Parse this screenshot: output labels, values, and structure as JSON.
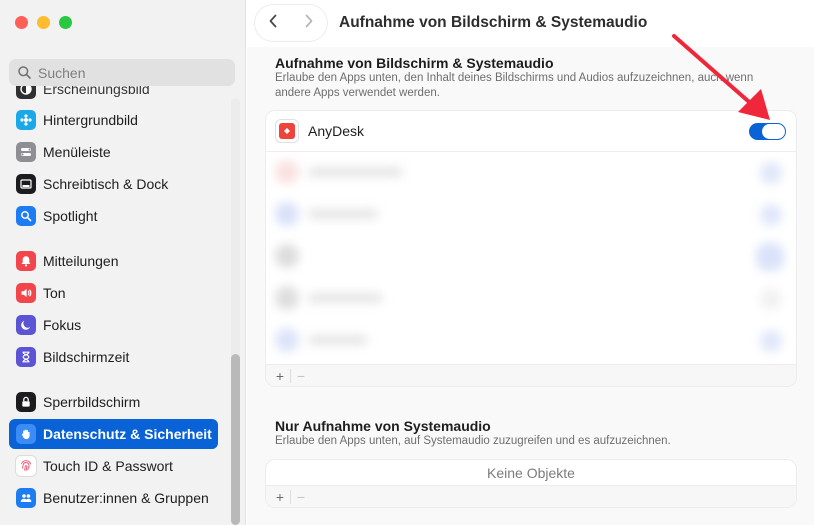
{
  "window": {
    "title": "Aufnahme von Bildschirm & Systemaudio"
  },
  "sidebar": {
    "search_placeholder": "Suchen",
    "hidden_item": "Erscheinungsbild",
    "items": [
      {
        "label": "Hintergrundbild",
        "icon": "wallpaper-icon",
        "color": "#1aa9e8"
      },
      {
        "label": "Menüleiste",
        "icon": "menu-bar-icon",
        "color": "#8e8e93"
      },
      {
        "label": "Schreibtisch & Dock",
        "icon": "dock-icon",
        "color": "#1c1c1e"
      },
      {
        "label": "Spotlight",
        "icon": "spotlight-icon",
        "color": "#1e7cf2"
      },
      {
        "label": "Mitteilungen",
        "icon": "notifications-icon",
        "color": "#f2454c"
      },
      {
        "label": "Ton",
        "icon": "sound-icon",
        "color": "#f2454c"
      },
      {
        "label": "Fokus",
        "icon": "focus-icon",
        "color": "#5b55d6"
      },
      {
        "label": "Bildschirmzeit",
        "icon": "screen-time-icon",
        "color": "#5b55d6"
      },
      {
        "label": "Sperrbildschirm",
        "icon": "lock-screen-icon",
        "color": "#1c1c1e"
      },
      {
        "label": "Datenschutz & Sicherheit",
        "icon": "privacy-hand-icon",
        "color": "#1e7cf2",
        "active": true
      },
      {
        "label": "Touch ID & Passwort",
        "icon": "fingerprint-icon",
        "color": "#ffffff"
      },
      {
        "label": "Benutzer:innen & Gruppen",
        "icon": "users-icon",
        "color": "#1e7cf2"
      }
    ]
  },
  "screen_audio": {
    "title": "Aufnahme von Bildschirm & Systemaudio",
    "description": "Erlaube den Apps unten, den Inhalt deines Bildschirms und Audios aufzuzeichnen, auch wenn andere Apps verwendet werden.",
    "apps": [
      {
        "name": "AnyDesk",
        "enabled": true,
        "icon": "anydesk-icon",
        "color": "#ef443b"
      }
    ],
    "add_label": "+",
    "remove_label": "−"
  },
  "system_audio": {
    "title": "Nur Aufnahme von Systemaudio",
    "description": "Erlaube den Apps unten, auf Systemaudio zuzugreifen und es aufzuzeichnen.",
    "empty_label": "Keine Objekte",
    "add_label": "+",
    "remove_label": "−"
  },
  "annotation": {
    "arrow_color": "#f0263a"
  }
}
